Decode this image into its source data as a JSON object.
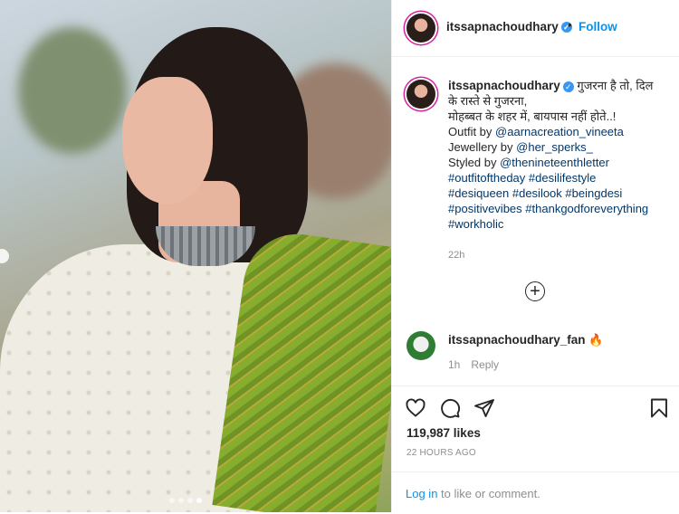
{
  "post": {
    "username": "itssapnachoudhary",
    "follow_label": "Follow",
    "separator": "•",
    "verified_icon": "check-badge-icon",
    "caption": {
      "hindi_1": "गुजरना है तो, दिल",
      "hindi_2": "के रास्ते से गुजरना,",
      "hindi_3": "मोहब्बत के शहर में, बायपास नहीं होते..!",
      "outfit_prefix": "Outfit by ",
      "outfit_handle": "@aarnacreation_vineeta",
      "jewellery_prefix": "Jewellery by ",
      "jewellery_handle": "@her_sperks_",
      "styled_prefix": "Styled by ",
      "styled_handle": "@thenineteenthletter",
      "tags": [
        "#outfitoftheday",
        "#desilifestyle",
        "#desiqueen",
        "#desilook",
        "#beingdesi",
        "#positivevibes",
        "#thankgodforeverything",
        "#workholic"
      ],
      "time": "22h"
    },
    "comment": {
      "username": "itssapnachoudhary_fan",
      "emoji": "🔥",
      "time": "1h",
      "reply_label": "Reply"
    },
    "likes": "119,987 likes",
    "posted": "22 HOURS AGO",
    "login_link": "Log in",
    "login_rest": " to like or comment.",
    "carousel": {
      "count": 4,
      "active": 4
    }
  },
  "colors": {
    "link": "#00376b",
    "accent": "#0095f6",
    "muted": "#8e8e8e",
    "text": "#262626"
  }
}
